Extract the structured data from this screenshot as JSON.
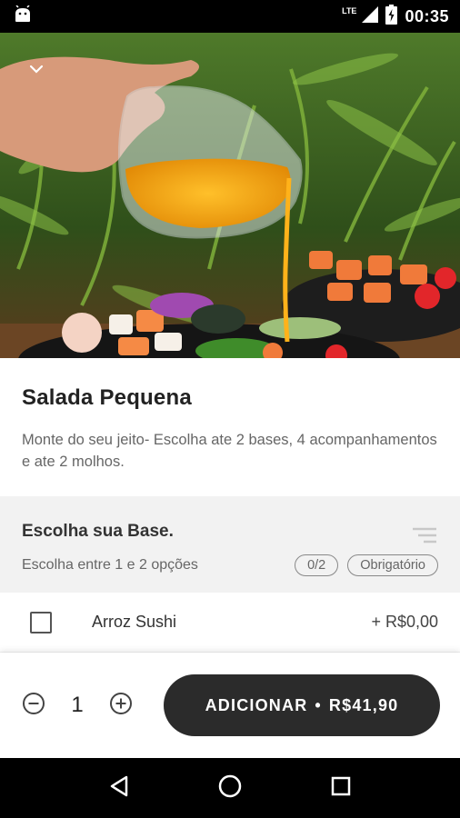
{
  "status_bar": {
    "time": "00:35",
    "network": "LTE",
    "icons": [
      "android-icon",
      "signal-icon",
      "battery-icon"
    ]
  },
  "product": {
    "title": "Salada Pequena",
    "description": "Monte do seu jeito- Escolha  ate 2 bases, 4 acompanhamentos e ate 2 molhos."
  },
  "group": {
    "title": "Escolha sua Base.",
    "subtitle": "Escolha entre 1 e 2 opções",
    "count_badge": "0/2",
    "required_badge": "Obrigatório"
  },
  "options": [
    {
      "label": "Arroz Sushi",
      "price": "+ R$0,00",
      "checked": false
    }
  ],
  "footer": {
    "quantity": "1",
    "add_label": "ADICIONAR",
    "separator": "•",
    "add_price": "R$41,90"
  },
  "colors": {
    "primary_button": "#2b2b2b",
    "group_bg": "#f2f2f2",
    "text_muted": "#666666"
  }
}
